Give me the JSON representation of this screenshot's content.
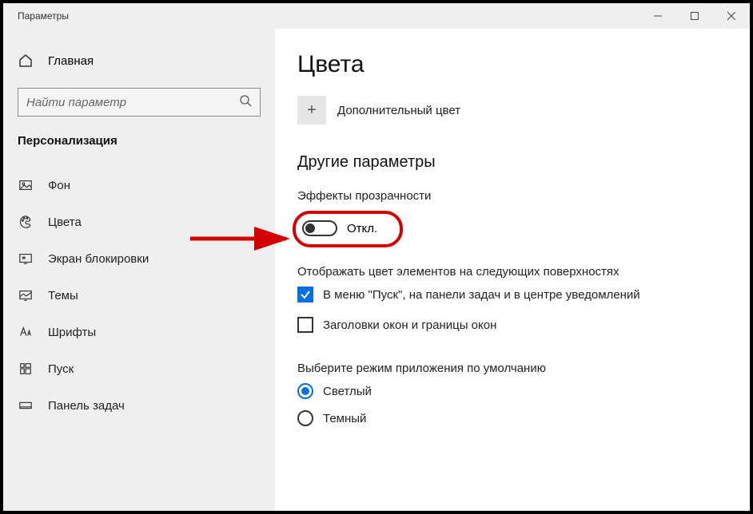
{
  "window": {
    "title": "Параметры"
  },
  "sidebar": {
    "home": "Главная",
    "search_placeholder": "Найти параметр",
    "category": "Персонализация",
    "items": [
      {
        "label": "Фон"
      },
      {
        "label": "Цвета"
      },
      {
        "label": "Экран блокировки"
      },
      {
        "label": "Темы"
      },
      {
        "label": "Шрифты"
      },
      {
        "label": "Пуск"
      },
      {
        "label": "Панель задач"
      }
    ]
  },
  "content": {
    "title": "Цвета",
    "add_color": "Дополнительный цвет",
    "more_heading": "Другие параметры",
    "transparency": {
      "label": "Эффекты прозрачности",
      "state": "Откл."
    },
    "surfaces_label": "Отображать цвет элементов на следующих поверхностях",
    "checkboxes": [
      {
        "label": "В меню \"Пуск\", на панели задач и в центре уведомлений",
        "checked": true
      },
      {
        "label": "Заголовки окон и границы окон",
        "checked": false
      }
    ],
    "appmode_label": "Выберите режим приложения по умолчанию",
    "radios": [
      {
        "label": "Светлый",
        "selected": true
      },
      {
        "label": "Темный",
        "selected": false
      }
    ]
  }
}
